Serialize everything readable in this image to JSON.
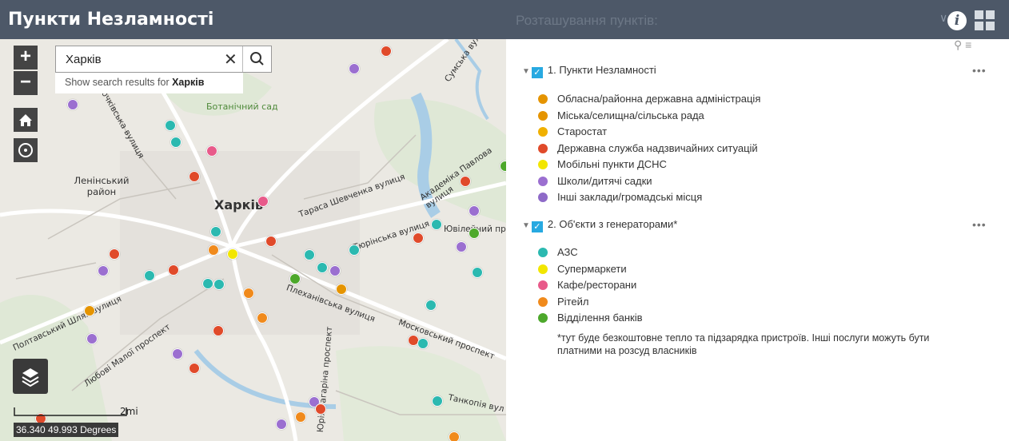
{
  "header": {
    "title": "Пункти Незламності"
  },
  "panel": {
    "title": "Розташування пунктів:"
  },
  "search": {
    "value": "Харків",
    "suggestion_prefix": "Show search results for",
    "suggestion_term": "Харків"
  },
  "map": {
    "labels": {
      "kharkiv": "Харків",
      "leninskyi": "Ленінський район",
      "botanical": "Ботанічний сад",
      "shevchenko": "Тараса Шевченка вулиця",
      "pavlova": "Академіка Павлова вулиця",
      "yuvileinyi": "Ювілейний пр",
      "turbulka": "Тюрінська вулиця",
      "plekhanivska": "Плеханівська вулиця",
      "moskovskyi": "Московський проспект",
      "poltavskyi": "Полтавський Шлях вулиця",
      "liubovi": "Любові Малої проспект",
      "gagarina": "Юрія Гагаріна проспект",
      "tankopia": "Танкопія вул",
      "sumska": "Сумська вулиця",
      "klochkivska": "Клочківська вулиця"
    },
    "scale_label": "2mi",
    "coordinates": "36.340 49.993 Degrees"
  },
  "legend": {
    "group1": {
      "title": "1. Пункти Незламності",
      "items": [
        {
          "label": "Обласна/районна державна адміністрація",
          "color": "#e59400"
        },
        {
          "label": "Міська/селищна/сільська рада",
          "color": "#e59400"
        },
        {
          "label": "Старостат",
          "color": "#f0b000"
        },
        {
          "label": "Державна служба надзвичайних ситуацій",
          "color": "#e04a2a"
        },
        {
          "label": "Мобільні пункти ДСНС",
          "color": "#f2e600"
        },
        {
          "label": "Школи/дитячі садки",
          "color": "#9b6fd0"
        },
        {
          "label": "Інші заклади/громадські місця",
          "color": "#8e6ac8"
        }
      ]
    },
    "group2": {
      "title": "2. Об'єкти з генераторами*",
      "items": [
        {
          "label": "АЗС",
          "color": "#2bb9b0"
        },
        {
          "label": "Супермаркети",
          "color": "#f2e600"
        },
        {
          "label": "Кафе/ресторани",
          "color": "#e85a8a"
        },
        {
          "label": "Рітейл",
          "color": "#f08a1c"
        },
        {
          "label": "Відділення банків",
          "color": "#4da82b"
        }
      ],
      "note": "*тут буде безкоштовне тепло та підзарядка пристроїв. Інші послуги можуть бути платними на розсуд власників"
    }
  }
}
